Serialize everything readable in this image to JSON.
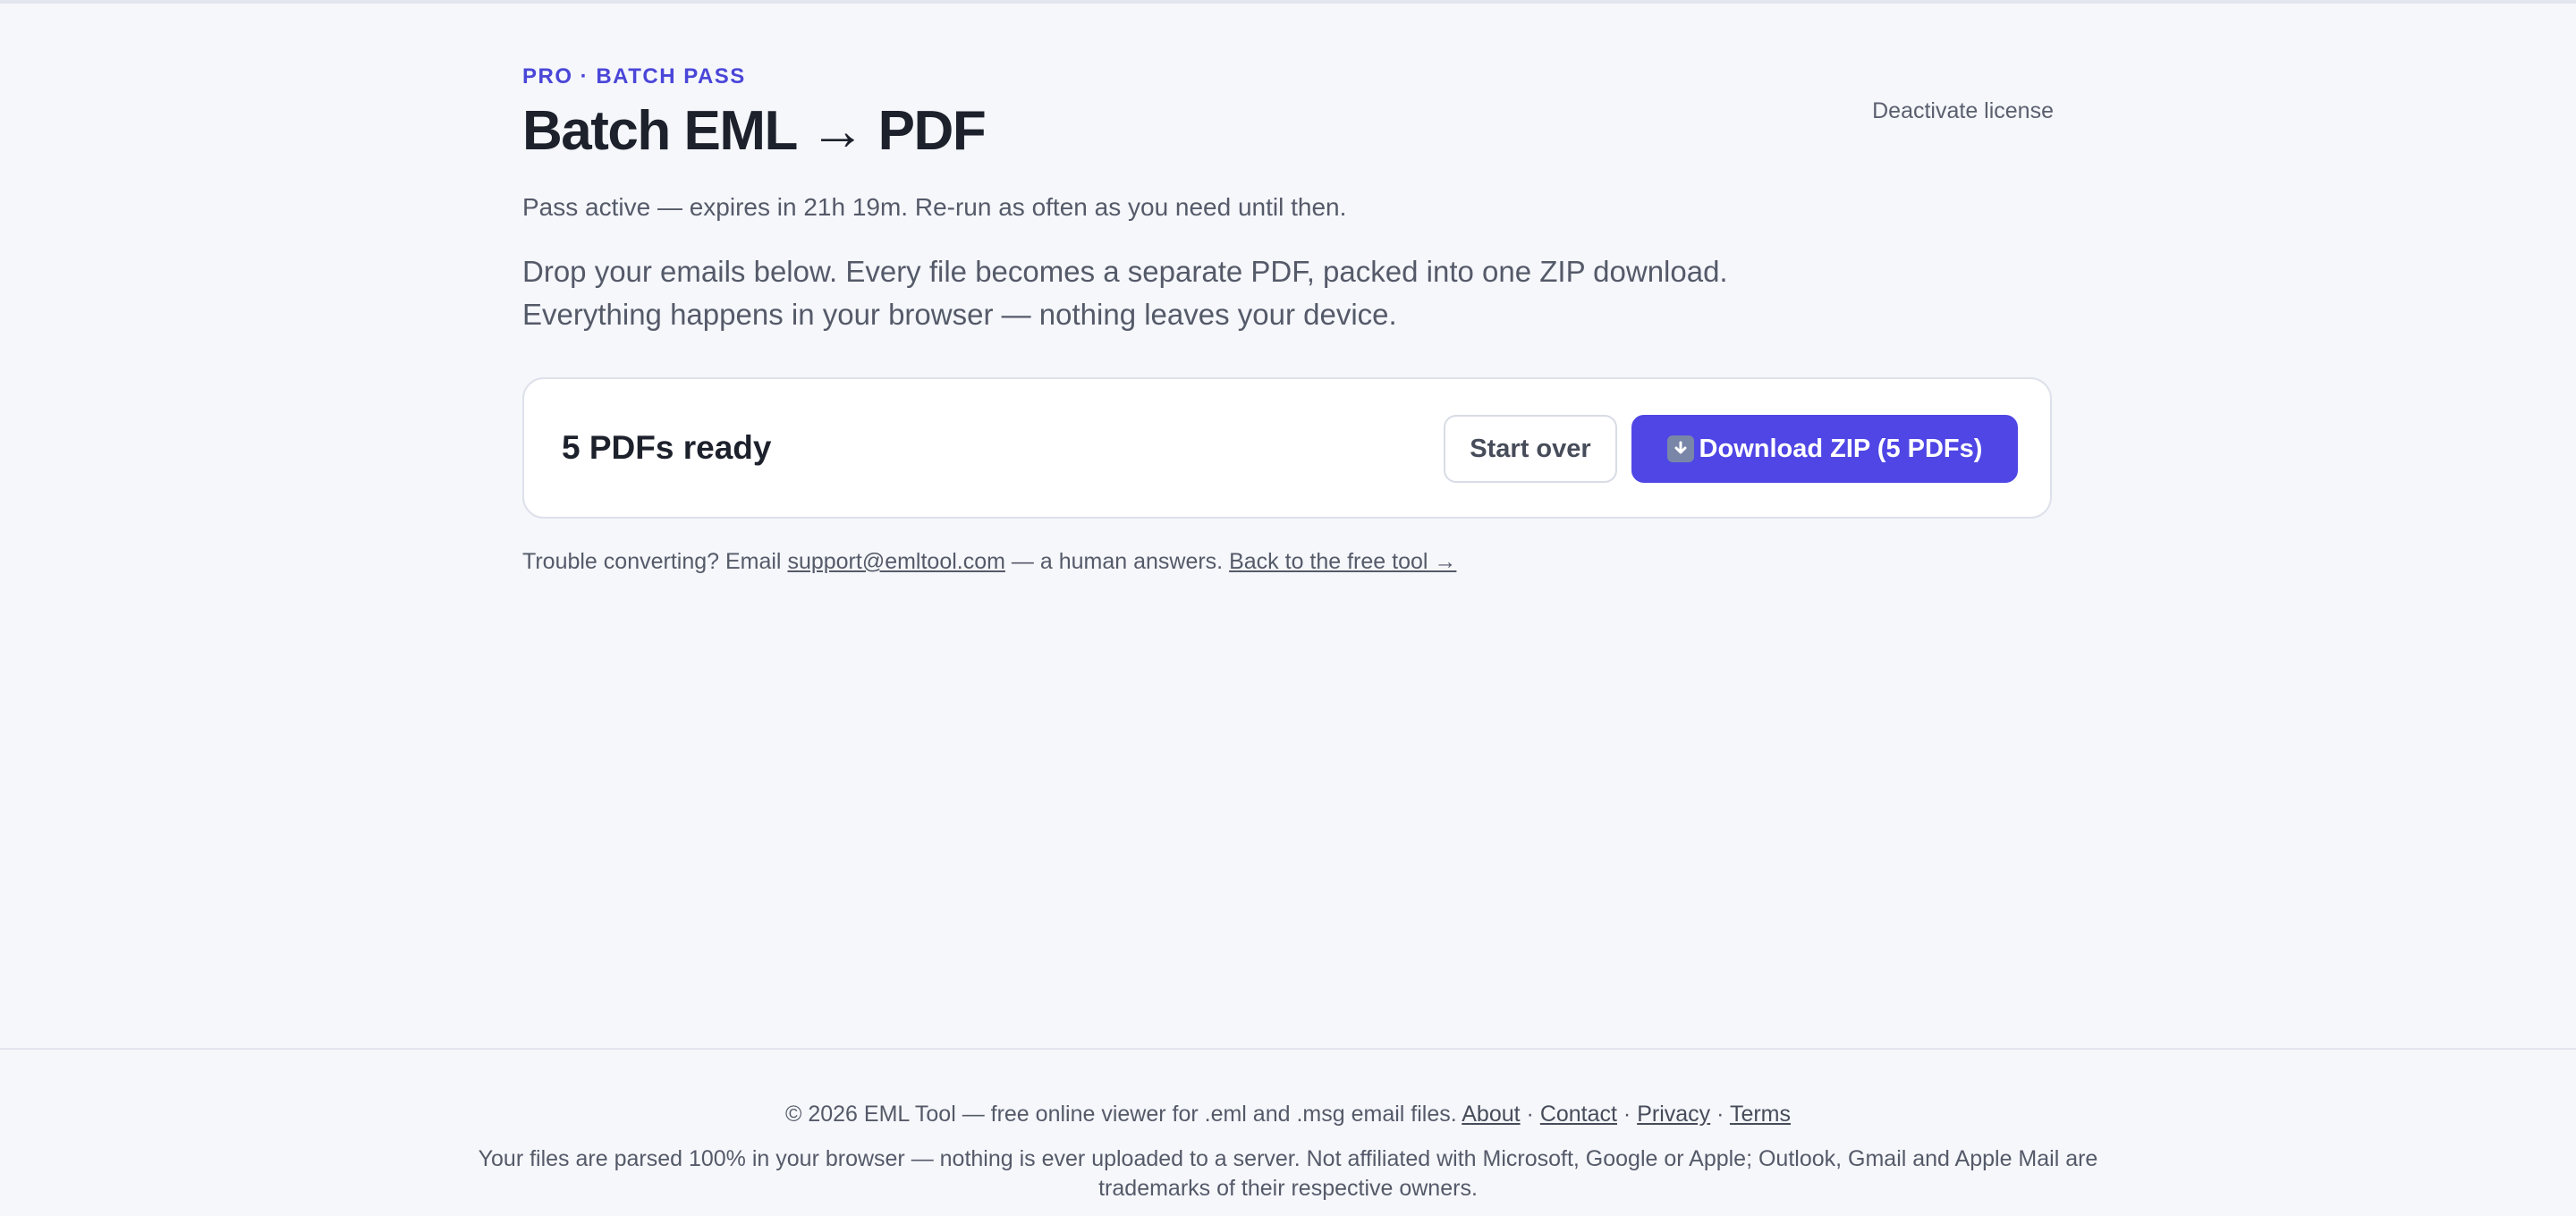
{
  "header": {
    "eyebrow": "PRO · BATCH PASS",
    "title": "Batch EML → PDF",
    "deactivate_label": "Deactivate license"
  },
  "pass_status": "Pass active — expires in 21h 19m. Re-run as often as you need until then.",
  "intro": {
    "line1": "Drop your emails below. Every file becomes a separate PDF, packed into one ZIP download.",
    "line2": "Everything happens in your browser — nothing leaves your device."
  },
  "result": {
    "ready_label": "5 PDFs ready",
    "start_over_label": "Start over",
    "download_icon": "download-arrow-icon",
    "download_label": "Download ZIP (5 PDFs)"
  },
  "help": {
    "prefix": "Trouble converting? Email ",
    "email": "support@emltool.com",
    "middle": " — a human answers. ",
    "back_link": "Back to the free tool →"
  },
  "footer": {
    "copyright": "© 2026 EML Tool — free online viewer for .eml and .msg email files. ",
    "links": {
      "about": "About",
      "contact": "Contact",
      "privacy": "Privacy",
      "terms": "Terms"
    },
    "separator": " · ",
    "disclaimer": "Your files are parsed 100% in your browser — nothing is ever uploaded to a server. Not affiliated with Microsoft, Google or Apple; Outlook, Gmail and Apple Mail are trademarks of their respective owners."
  },
  "colors": {
    "background": "#f5f7fb",
    "accent": "#4f46e5",
    "eyebrow": "#4a46d8",
    "text_primary": "#1d212c",
    "text_muted": "#555a69"
  }
}
